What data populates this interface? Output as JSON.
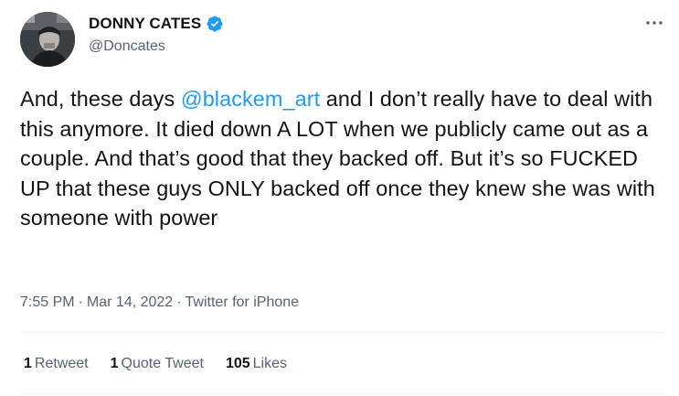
{
  "author": {
    "name": "DONNY CATES",
    "handle": "@Doncates",
    "verified": true
  },
  "tweet": {
    "text_before": "And,  these days ",
    "mention": "@blackem_art",
    "text_after": " and I don’t really have to deal with this anymore. It died down A LOT when we publicly came out as a couple. And that’s good that they backed off. But it’s  so FUCKED UP that these guys ONLY backed off once they knew she was with someone with power"
  },
  "meta": {
    "time": "7:55 PM",
    "separator": "·",
    "date": "Mar 14, 2022",
    "source": "Twitter for iPhone"
  },
  "stats": {
    "retweets_count": "1",
    "retweets_label": "Retweet",
    "quotes_count": "1",
    "quotes_label": "Quote Tweet",
    "likes_count": "105",
    "likes_label": "Likes"
  },
  "colors": {
    "link": "#1d9bf0",
    "secondary_text": "#536471",
    "primary_text": "#0f1419",
    "verified_badge": "#1d9bf0"
  },
  "icons": {
    "verified": "verified-badge-icon",
    "more": "more-horizontal-icon"
  }
}
